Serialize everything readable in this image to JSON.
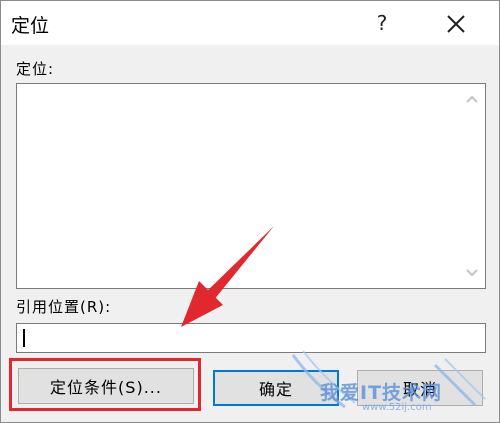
{
  "dialog": {
    "title": "定位",
    "help_icon": "?",
    "close_icon": "close-icon"
  },
  "goto": {
    "label": "定位:",
    "items": []
  },
  "reference": {
    "label": "引用位置(R):",
    "value": ""
  },
  "buttons": {
    "special": "定位条件(S)...",
    "ok": "确定",
    "cancel": "取消"
  },
  "annotation": {
    "arrow_color": "#e0282e",
    "highlight_color": "#e0282e"
  },
  "watermark": {
    "main": "我爱IT技术网",
    "sub": "www.52ij.com"
  }
}
